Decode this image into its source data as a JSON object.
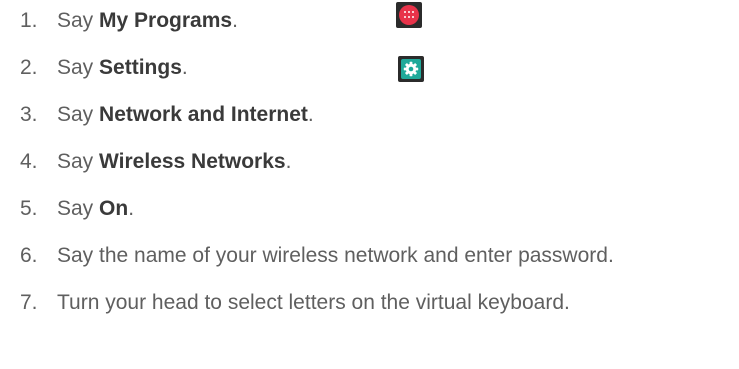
{
  "steps": [
    {
      "number": "1.",
      "prefix": "Say ",
      "bold": "My Programs",
      "suffix": "."
    },
    {
      "number": "2.",
      "prefix": "Say ",
      "bold": "Settings",
      "suffix": "."
    },
    {
      "number": "3.",
      "prefix": "Say ",
      "bold": "Network and Internet",
      "suffix": "."
    },
    {
      "number": "4.",
      "prefix": "Say ",
      "bold": "Wireless Networks",
      "suffix": "."
    },
    {
      "number": "5.",
      "prefix": "Say ",
      "bold": "On",
      "suffix": "."
    },
    {
      "number": "6.",
      "text": "Say the name of your wireless network and enter password."
    },
    {
      "number": "7.",
      "text": "Turn your head to select letters on the virtual keyboard."
    }
  ],
  "icons": {
    "apps": {
      "name": "apps-grid-icon",
      "color": "#e8334a"
    },
    "settings": {
      "name": "gear-icon",
      "color": "#20a99a"
    }
  }
}
